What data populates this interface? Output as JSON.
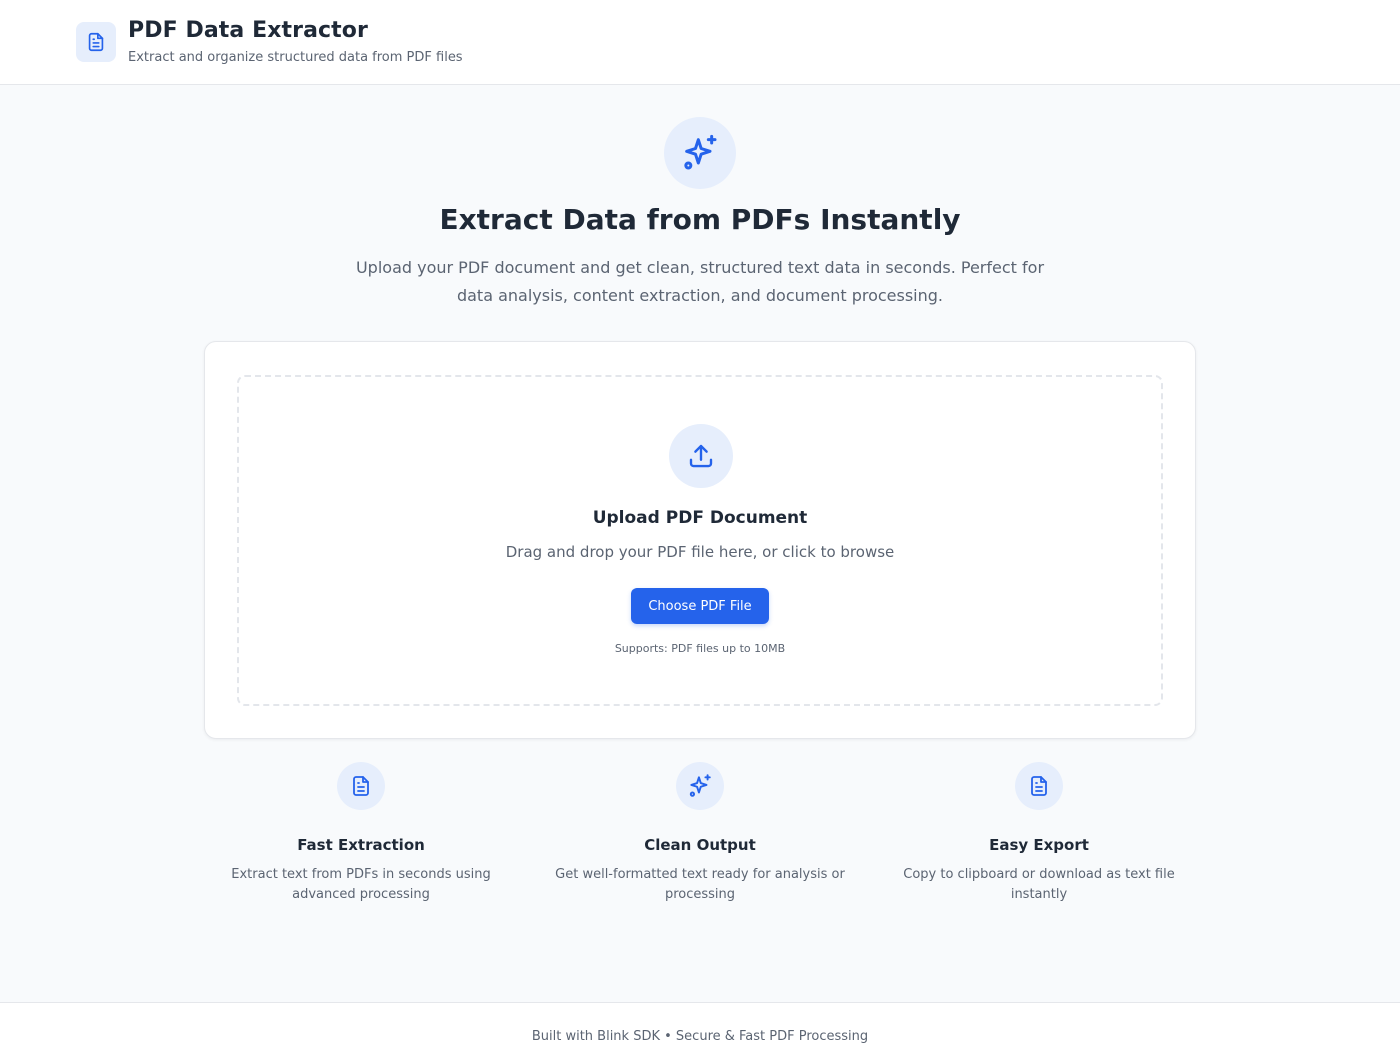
{
  "header": {
    "title": "PDF Data Extractor",
    "subtitle": "Extract and organize structured data from PDF files",
    "logo_icon": "document-icon"
  },
  "hero": {
    "icon": "sparkles-icon",
    "title": "Extract Data from PDFs Instantly",
    "description": "Upload your PDF document and get clean, structured text data in seconds. Perfect for data analysis, content extraction, and document processing."
  },
  "upload": {
    "icon": "upload-icon",
    "title": "Upload PDF Document",
    "hint": "Drag and drop your PDF file here, or click to browse",
    "button_label": "Choose PDF File",
    "support_note": "Supports: PDF files up to 10MB"
  },
  "features": [
    {
      "icon": "document-icon",
      "title": "Fast Extraction",
      "description": "Extract text from PDFs in seconds using advanced processing"
    },
    {
      "icon": "sparkles-icon",
      "title": "Clean Output",
      "description": "Get well-formatted text ready for analysis or processing"
    },
    {
      "icon": "document-icon",
      "title": "Easy Export",
      "description": "Copy to clipboard or download as text file instantly"
    }
  ],
  "footer": {
    "text": "Built with Blink SDK • Secure & Fast PDF Processing"
  },
  "colors": {
    "accent": "#2563eb",
    "icon_bg": "#e6eefc",
    "page_bg": "#f8fafc",
    "text_primary": "#1f2937",
    "text_muted": "#5b6472"
  }
}
